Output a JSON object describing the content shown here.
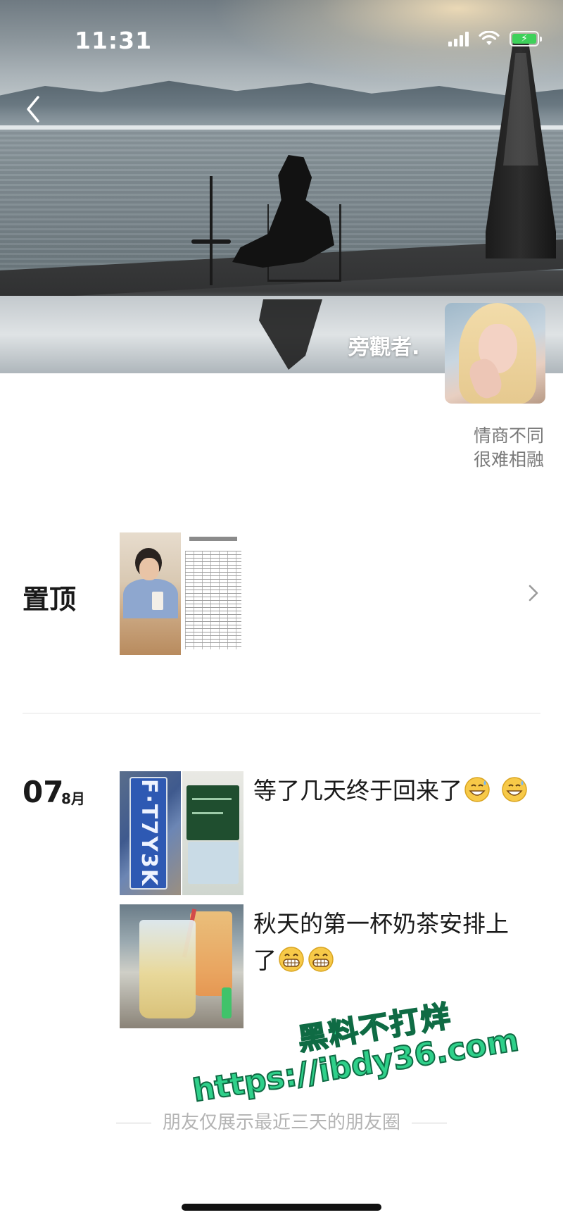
{
  "status_bar": {
    "time": "11:31",
    "battery_color": "#3ed15a",
    "battery_glyph": "⚡"
  },
  "profile": {
    "nickname": "旁觀者.",
    "signature_line1": "情商不同",
    "signature_line2": "很难相融"
  },
  "pinned": {
    "label": "置顶"
  },
  "moments": {
    "date_day": "07",
    "date_month": "8月",
    "posts": [
      {
        "text": "等了几天终于回来了",
        "emoji": [
          "grinning-sweat-emoji",
          "grinning-sweat-emoji"
        ],
        "thumb_plate_text": "F·T7Y3K"
      },
      {
        "text": "秋天的第一杯奶茶安排上了",
        "emoji": [
          "grin-emoji",
          "grin-emoji"
        ]
      }
    ]
  },
  "footer": {
    "visible_text": "朋友仅展示最近三天的朋友圈"
  },
  "watermark": {
    "line1": "黑料不打烊",
    "line2": "https://ibdy36.com"
  },
  "colors": {
    "watermark_fill": "#2fd08a",
    "watermark_stroke": "#0f6b44",
    "secondary_text": "#7a7a7a"
  }
}
